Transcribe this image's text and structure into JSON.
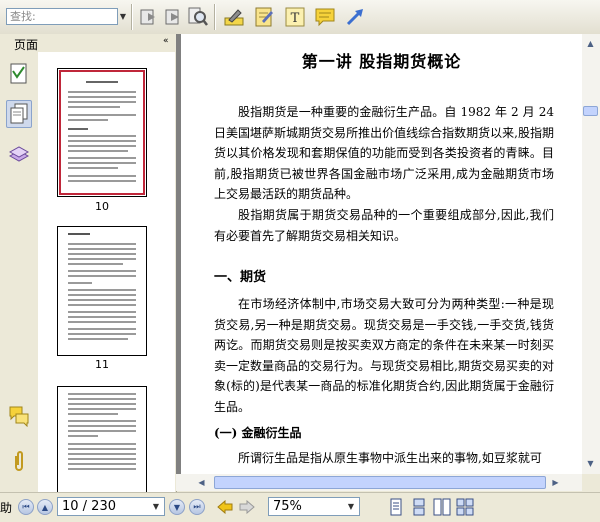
{
  "toolbar": {
    "search_placeholder": "查找:",
    "tools": [
      "back-icon",
      "next-icon",
      "find-icon",
      "highlighter-icon",
      "notepad-icon",
      "text-tool-icon",
      "comment-icon",
      "arrow-tool-icon"
    ]
  },
  "sidebar": {
    "title": "页面",
    "collapse": "«",
    "thumbnails": [
      {
        "label": "10",
        "selected": true
      },
      {
        "label": "11",
        "selected": false
      },
      {
        "label": "",
        "selected": false
      }
    ]
  },
  "document": {
    "title": "第一讲  股指期货概论",
    "paragraphs": [
      "股指期货是一种重要的金融衍生产品。自 1982 年 2 月 24 日美国堪萨斯城期货交易所推出价值线综合指数期货以来,股指期货以其价格发现和套期保值的功能而受到各类投资者的青睐。目前,股指期货已被世界各国金融市场广泛采用,成为金融期货市场上交易最活跃的期货品种。",
      "股指期货属于期货交易品种的一个重要组成部分,因此,我们有必要首先了解期货交易相关知识。"
    ],
    "section1": "一、期货",
    "paragraph3": "在市场经济体制中,市场交易大致可分为两种类型:一种是现货交易,另一种是期货交易。现货交易是一手交钱,一手交货,钱货两讫。而期货交易则是按买卖双方商定的条件在未来某一时刻买卖一定数量商品的交易行为。与现货交易相比,期货交易买卖的对象(标的)是代表某一商品的标准化期货合约,因此期货属于金融衍生品。",
    "subsection": "(一) 金融衍生品",
    "paragraph4": "所谓衍生品是指从原生事物中派生出来的事物,如豆浆就可"
  },
  "statusbar": {
    "page_value": "10 / 230",
    "zoom_value": "75%",
    "left_cut": "助"
  }
}
